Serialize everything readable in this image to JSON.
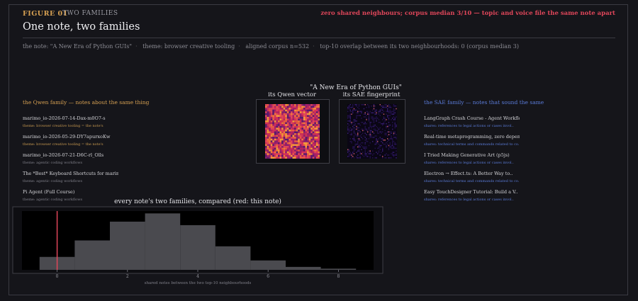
{
  "figure": {
    "number": "FIGURE 01",
    "tag": "TWO FAMILIES",
    "headline": "zero shared neighbours; corpus median 3/10 — topic and voice file the same note apart",
    "title": "One note, two families"
  },
  "meta": {
    "note": "the note: \"A New Era of Python GUIs\"",
    "theme": "theme: browser creative tooling",
    "corpus": "aligned corpus n=532",
    "overlap": "top-10 overlap between its two neighbourhoods: 0 (corpus median 3)"
  },
  "qwen": {
    "heading": "the Qwen family — notes about the same thing",
    "items": [
      {
        "name": "marimo_io-2026-07-14-Dax-m0O7-s",
        "sub": "theme: browser creative tooling  = the note's",
        "tone": "gold"
      },
      {
        "name": "marimo_io-2026-05-29-DY7apurxoKw",
        "sub": "theme: browser creative tooling  = the note's",
        "tone": "gold"
      },
      {
        "name": "marimo_io-2026-07-21-D6C-rl_Olls",
        "sub": "theme: agentic coding workflows",
        "tone": "grey"
      },
      {
        "name": "The *Best* Keyboard Shortcuts for marimo",
        "sub": "theme: agentic coding workflows",
        "tone": "grey"
      },
      {
        "name": "Pi Agent (Full Course)",
        "sub": "theme: agentic coding workflows",
        "tone": "grey"
      }
    ]
  },
  "sae": {
    "heading": "the SAE family — notes that sound the same",
    "items": [
      {
        "name": "LangGraph Crash Course - Agent Workflo..",
        "sub": "shares: references to legal actions or cases invol.."
      },
      {
        "name": "Real-time metaprogramming, zero depend..",
        "sub": "shares: technical terms and commands related to co.."
      },
      {
        "name": "I Tried Making Generative Art (p5js)",
        "sub": "shares: references to legal actions or cases invol.."
      },
      {
        "name": "Electron → Effect.ts: A Better Way to..",
        "sub": "shares: technical terms and commands related to co.."
      },
      {
        "name": "Easy TouchDesigner Tutorial: Build a V..",
        "sub": "shares: references to legal actions or cases invol.."
      }
    ]
  },
  "center": {
    "title": "\"A New Era of Python GUIs\"",
    "qwen_label": "its Qwen vector",
    "sae_label": "its SAE fingerprint"
  },
  "colors": {
    "gold": "#d6a052",
    "blue": "#5a7bd8",
    "red": "#e0465a",
    "bar": "#4a4a4f"
  },
  "chart_data": {
    "type": "bar",
    "title": "every note's two families, compared (red: this note)",
    "xlabel": "shared notes between the two top-10 neighbourhoods",
    "ylabel": "",
    "categories": [
      0,
      1,
      2,
      3,
      4,
      5,
      6,
      7,
      8
    ],
    "values": [
      22,
      50,
      82,
      96,
      76,
      40,
      16,
      5,
      2
    ],
    "x_ticks": [
      0,
      2,
      4,
      6,
      8
    ],
    "xlim": [
      -1,
      9
    ],
    "ylim": [
      0,
      100
    ],
    "highlight": {
      "label": "this note",
      "x": 0
    }
  }
}
